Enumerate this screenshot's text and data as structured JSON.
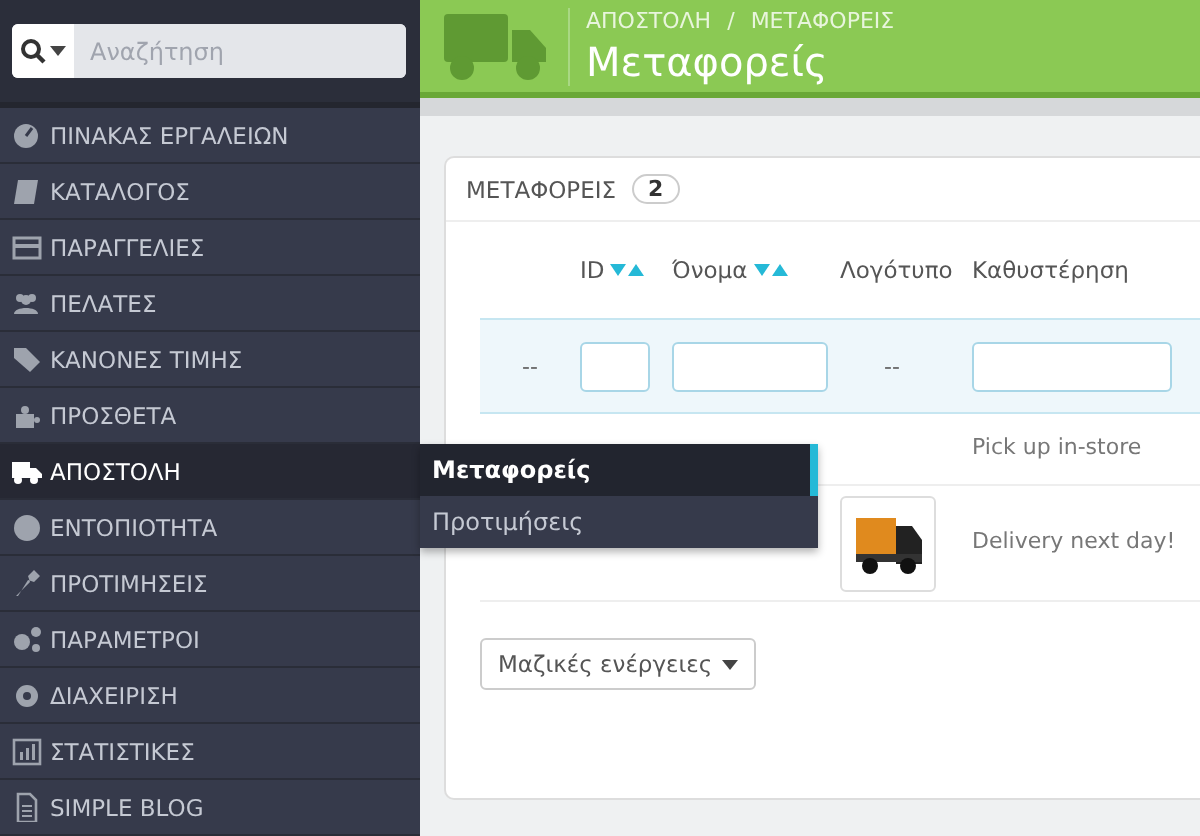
{
  "search": {
    "placeholder": "Αναζήτηση"
  },
  "sidebar": {
    "items": [
      {
        "label": "ΠΙΝΑΚΑΣ ΕΡΓΑΛΕΙΩΝ",
        "selected": false
      },
      {
        "label": "ΚΑΤΑΛΟΓΟΣ",
        "selected": false
      },
      {
        "label": "ΠΑΡΑΓΓΕΛΙΕΣ",
        "selected": false
      },
      {
        "label": "ΠΕΛΑΤΕΣ",
        "selected": false
      },
      {
        "label": "ΚΑΝΟΝΕΣ ΤΙΜΗΣ",
        "selected": false
      },
      {
        "label": "ΠΡΟΣΘΕΤΑ",
        "selected": false
      },
      {
        "label": "ΑΠΟΣΤΟΛΗ",
        "selected": true
      },
      {
        "label": "ΕΝΤΟΠΙΟΤΗΤΑ",
        "selected": false
      },
      {
        "label": "ΠΡΟΤΙΜΗΣΕΙΣ",
        "selected": false
      },
      {
        "label": "ΠΑΡΑΜΕΤΡΟΙ",
        "selected": false
      },
      {
        "label": "ΔΙΑΧΕΙΡΙΣΗ",
        "selected": false
      },
      {
        "label": "ΣΤΑΤΙΣΤΙΚΕΣ",
        "selected": false
      },
      {
        "label": "SIMPLE BLOG",
        "selected": false
      }
    ]
  },
  "submenu": {
    "items": [
      {
        "label": "Μεταφορείς",
        "selected": true
      },
      {
        "label": "Προτιμήσεις",
        "selected": false
      }
    ]
  },
  "header": {
    "breadcrumb": [
      "ΑΠΟΣΤΟΛΗ",
      "ΜΕΤΑΦΟΡΕΙΣ"
    ],
    "separator": "/",
    "title": "Μεταφορείς"
  },
  "panel": {
    "title": "ΜΕΤΑΦΟΡΕΙΣ",
    "count": "2"
  },
  "table": {
    "columns": [
      {
        "label": "ID",
        "sortable": true
      },
      {
        "label": "Όνομα",
        "sortable": true
      },
      {
        "label": "Λογότυπο",
        "sortable": false
      },
      {
        "label": "Καθυστέρηση",
        "sortable": false
      }
    ],
    "filter_placeholders": [
      "--",
      "--"
    ],
    "rows": [
      {
        "logo": false,
        "delay": "Pick up in-store"
      },
      {
        "logo": true,
        "delay": "Delivery next day!"
      }
    ]
  },
  "bulk_button": {
    "label": "Μαζικές ενέργειες"
  }
}
